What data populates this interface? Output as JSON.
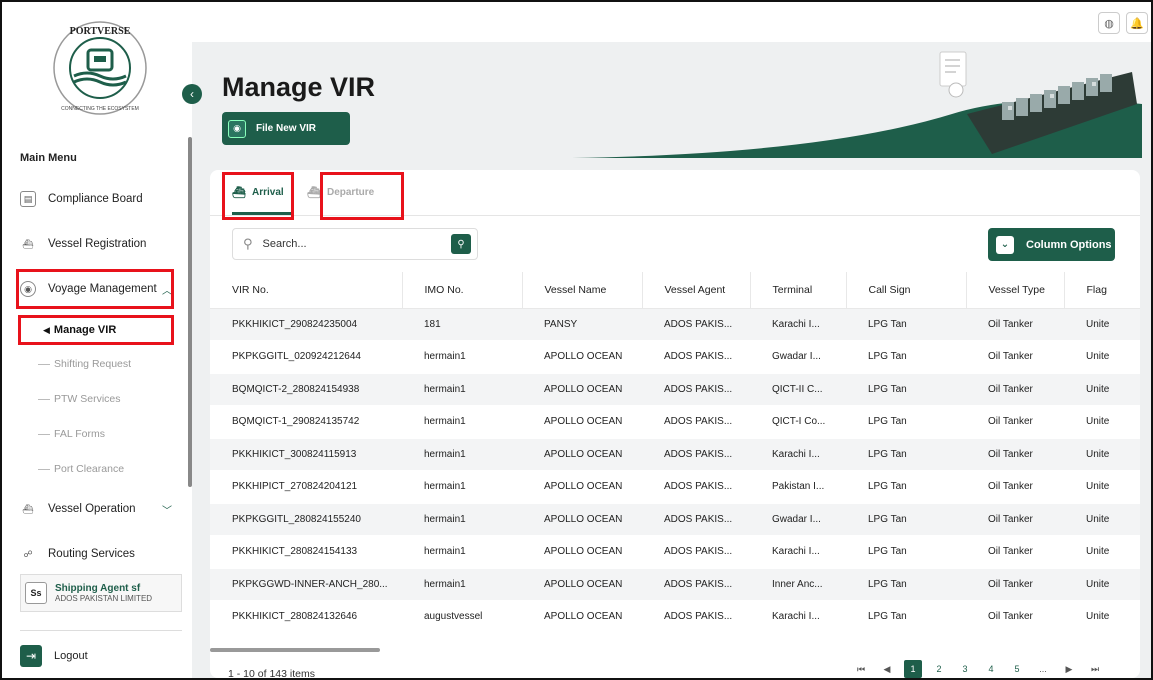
{
  "sidebar": {
    "logo_text_top": "PORTVERSE",
    "logo_text_bottom": "CONNECTING THE ECOSYSTEM",
    "main_menu_title": "Main Menu",
    "items": [
      {
        "label": "Compliance Board",
        "icon": "clipboard-icon"
      },
      {
        "label": "Vessel Registration",
        "icon": "ship-icon"
      },
      {
        "label": "Voyage Management",
        "icon": "location-pin-icon"
      },
      {
        "label": "Vessel Operation",
        "icon": "ship-operation-icon"
      },
      {
        "label": "Routing Services",
        "icon": "route-icon"
      }
    ],
    "sub_items": [
      {
        "label": "Manage VIR"
      },
      {
        "label": "Shifting Request"
      },
      {
        "label": "PTW Services"
      },
      {
        "label": "FAL Forms"
      },
      {
        "label": "Port Clearance"
      }
    ],
    "agent": {
      "initials": "Ss",
      "name": "Shipping Agent sf",
      "company": "ADOS PAKISTAN LIMITED"
    },
    "logout_label": "Logout"
  },
  "header": {
    "title": "Manage VIR",
    "file_button_label": "File New VIR"
  },
  "tabs": [
    {
      "label": "Arrival",
      "active": true
    },
    {
      "label": "Departure",
      "active": false
    }
  ],
  "search": {
    "placeholder": "Search..."
  },
  "column_options_label": "Column Options",
  "table": {
    "columns": [
      "VIR No.",
      "IMO No.",
      "Vessel Name",
      "Vessel Agent",
      "Terminal",
      "Call Sign",
      "Vessel Type",
      "Flag"
    ],
    "rows": [
      [
        "PKKHIKICT_290824235004",
        "181",
        "PANSY",
        "ADOS PAKIS...",
        "Karachi I...",
        "LPG Tan",
        "Oil Tanker",
        "Unite"
      ],
      [
        "PKPKGGITL_020924212644",
        "hermain1",
        "APOLLO OCEAN",
        "ADOS PAKIS...",
        "Gwadar I...",
        "LPG Tan",
        "Oil Tanker",
        "Unite"
      ],
      [
        "BQMQICT-2_280824154938",
        "hermain1",
        "APOLLO OCEAN",
        "ADOS PAKIS...",
        "QICT-II C...",
        "LPG Tan",
        "Oil Tanker",
        "Unite"
      ],
      [
        "BQMQICT-1_290824135742",
        "hermain1",
        "APOLLO OCEAN",
        "ADOS PAKIS...",
        "QICT-I Co...",
        "LPG Tan",
        "Oil Tanker",
        "Unite"
      ],
      [
        "PKKHIKICT_300824115913",
        "hermain1",
        "APOLLO OCEAN",
        "ADOS PAKIS...",
        "Karachi I...",
        "LPG Tan",
        "Oil Tanker",
        "Unite"
      ],
      [
        "PKKHIPICT_270824204121",
        "hermain1",
        "APOLLO OCEAN",
        "ADOS PAKIS...",
        "Pakistan I...",
        "LPG Tan",
        "Oil Tanker",
        "Unite"
      ],
      [
        "PKPKGGITL_280824155240",
        "hermain1",
        "APOLLO OCEAN",
        "ADOS PAKIS...",
        "Gwadar I...",
        "LPG Tan",
        "Oil Tanker",
        "Unite"
      ],
      [
        "PKKHIKICT_280824154133",
        "hermain1",
        "APOLLO OCEAN",
        "ADOS PAKIS...",
        "Karachi I...",
        "LPG Tan",
        "Oil Tanker",
        "Unite"
      ],
      [
        "PKPKGGWD-INNER-ANCH_280...",
        "hermain1",
        "APOLLO OCEAN",
        "ADOS PAKIS...",
        "Inner Anc...",
        "LPG Tan",
        "Oil Tanker",
        "Unite"
      ],
      [
        "PKKHIKICT_280824132646",
        "augustvessel",
        "APOLLO OCEAN",
        "ADOS PAKIS...",
        "Karachi I...",
        "LPG Tan",
        "Oil Tanker",
        "Unite"
      ]
    ]
  },
  "footer": {
    "count_text": "1 - 10 of 143 items",
    "pages": [
      "1",
      "2",
      "3",
      "4",
      "5",
      "..."
    ]
  },
  "colors": {
    "brand": "#1e5e4a",
    "highlight": "#e8121b"
  }
}
